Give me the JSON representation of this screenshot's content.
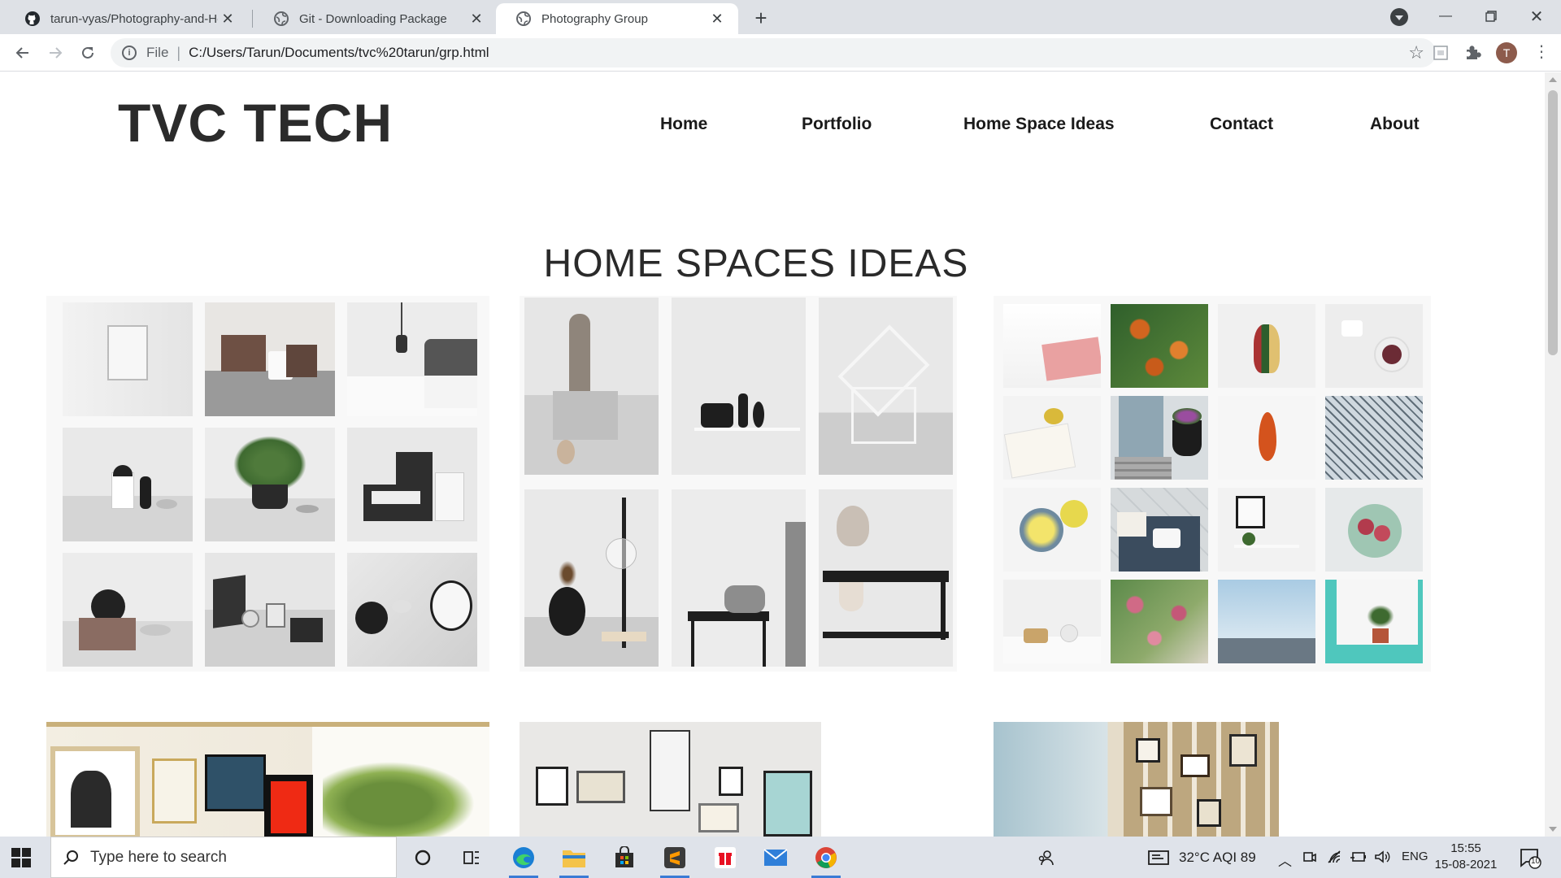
{
  "browser": {
    "tabs": [
      {
        "title": "tarun-vyas/Photography-and-Ho",
        "icon": "github-icon",
        "active": false
      },
      {
        "title": "Git - Downloading Package",
        "icon": "globe-icon",
        "active": false
      },
      {
        "title": "Photography Group",
        "icon": "globe-icon",
        "active": true
      }
    ],
    "address": {
      "scheme": "File",
      "url": "C:/Users/Tarun/Documents/tvc%20tarun/grp.html"
    },
    "profile_initial": "T"
  },
  "site": {
    "brand": "TVC TECH",
    "nav": [
      "Home",
      "Portfolio",
      "Home Space Ideas",
      "Contact",
      "About"
    ],
    "heading": "HOME SPACES IDEAS"
  },
  "taskbar": {
    "search_placeholder": "Type here to search",
    "weather": "32°C  AQI 89",
    "language": "ENG",
    "time": "15:55",
    "date": "15-08-2021",
    "notifications": "10"
  },
  "colors": {
    "tab_strip": "#dee1e6",
    "taskbar": "#dfe3ea",
    "brand_text": "#2b2b2b",
    "accent": "#3a7bd5"
  }
}
